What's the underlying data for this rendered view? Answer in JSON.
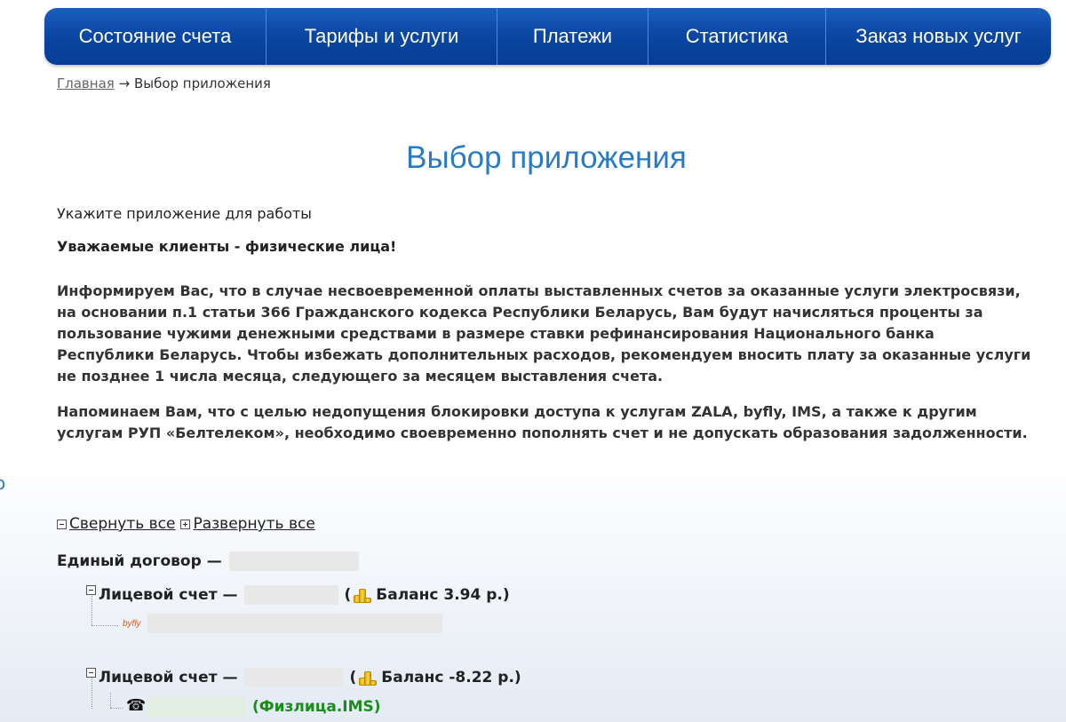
{
  "nav": {
    "items": [
      {
        "label": "Состояние счета"
      },
      {
        "label": "Тарифы и услуги"
      },
      {
        "label": "Платежи"
      },
      {
        "label": "Статистика"
      },
      {
        "label": "Заказ новых услуг"
      }
    ]
  },
  "breadcrumb": {
    "home": "Главная",
    "separator": "→",
    "current": "Выбор приложения"
  },
  "page": {
    "title": "Выбор приложения",
    "subtitle": "Укажите приложение для работы",
    "greeting": "Уважаемые клиенты - физические лица!",
    "paragraph1": "Информируем Вас, что в случае несвоевременной оплаты выставленных счетов за оказанные услуги электросвязи, на основании п.1 статьи 366 Гражданского кодекса Республики Беларусь, Вам будут начисляться проценты за пользование чужими денежными средствами в размере ставки рефинансирования Национального банка Республики Беларусь. Чтобы избежать дополнительных расходов, рекомендуем вносить плату  за оказанные услуги не позднее 1 числа месяца, следующего за месяцем выставления счета.",
    "paragraph2": "Напоминаем Вам, что с целью недопущения блокировки доступа к услугам ZALA, byfly, IMS, а также к другим услугам РУП «Белтелеком», необходимо своевременно пополнять счет и не допускать образования задолженности.",
    "edge_glyph": "o"
  },
  "tree": {
    "collapse_all": "Свернуть все",
    "expand_all": "Развернуть все",
    "contract_label": "Единый договор —",
    "accounts": [
      {
        "label": "Лицевой счет —",
        "open_paren": "(",
        "balance": "Баланс 3.94 р.)",
        "service_icon": "byfly",
        "service_label": ""
      },
      {
        "label": "Лицевой счет —",
        "open_paren": "(",
        "balance": "Баланс -8.22 р.)",
        "service_icon": "phone-icon",
        "service_label": "(Физлица.IMS)"
      }
    ]
  },
  "colors": {
    "nav_bg": "#0b47a3",
    "title": "#2a7bc7",
    "ims_green": "#1c8c1c"
  }
}
